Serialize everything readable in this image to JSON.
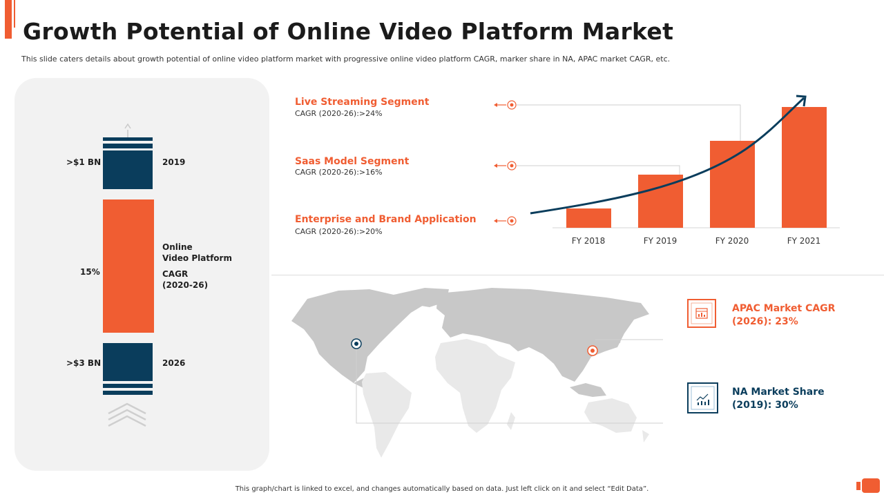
{
  "header": {
    "title": "Growth Potential of Online Video Platform Market",
    "subtitle": "This slide caters details about growth potential of online video platform market with progressive online video platform CAGR, marker share in NA, APAC market CAGR, etc."
  },
  "left_panel": {
    "value_2019": ">$1 BN",
    "year_2019": "2019",
    "cagr_value": "15%",
    "cagr_label_line1": "Online",
    "cagr_label_line2": "Video Platform",
    "cagr_label_line3": "CAGR",
    "cagr_label_line4": "(2020-26)",
    "value_2026": ">$3 BN",
    "year_2026": "2026"
  },
  "segments": [
    {
      "title": "Live Streaming Segment",
      "subtitle": "CAGR  (2020-26):>24%"
    },
    {
      "title": "Saas Model Segment",
      "subtitle": "CAGR  (2020-26):>16%"
    },
    {
      "title": "Enterprise and Brand Application",
      "subtitle": "CAGR  (2020-26):>20%"
    }
  ],
  "regions": {
    "apac_line1": "APAC Market CAGR",
    "apac_line2": "(2026): 23%",
    "na_line1": "NA Market Share",
    "na_line2": "(2019): 30%"
  },
  "footer": "This graph/chart is linked to excel, and changes automatically based on data. Just left click on it and select “Edit Data”.",
  "colors": {
    "accent": "#f05d32",
    "navy": "#0a3d5c",
    "panel": "#f2f2f2",
    "map": "#c8c8c8"
  },
  "icons": [
    "calendar-chart-icon",
    "growth-chart-icon",
    "map-pin-icon"
  ],
  "chart_data": {
    "type": "bar",
    "categories": [
      "FY 2018",
      "FY 2019",
      "FY 2020",
      "FY 2021"
    ],
    "values": [
      2,
      5.5,
      9,
      12.5
    ],
    "title": "",
    "xlabel": "",
    "ylabel": "",
    "ylim": [
      0,
      14
    ],
    "grid": false,
    "trend_arrow": true,
    "bar_color": "#f05d32"
  }
}
